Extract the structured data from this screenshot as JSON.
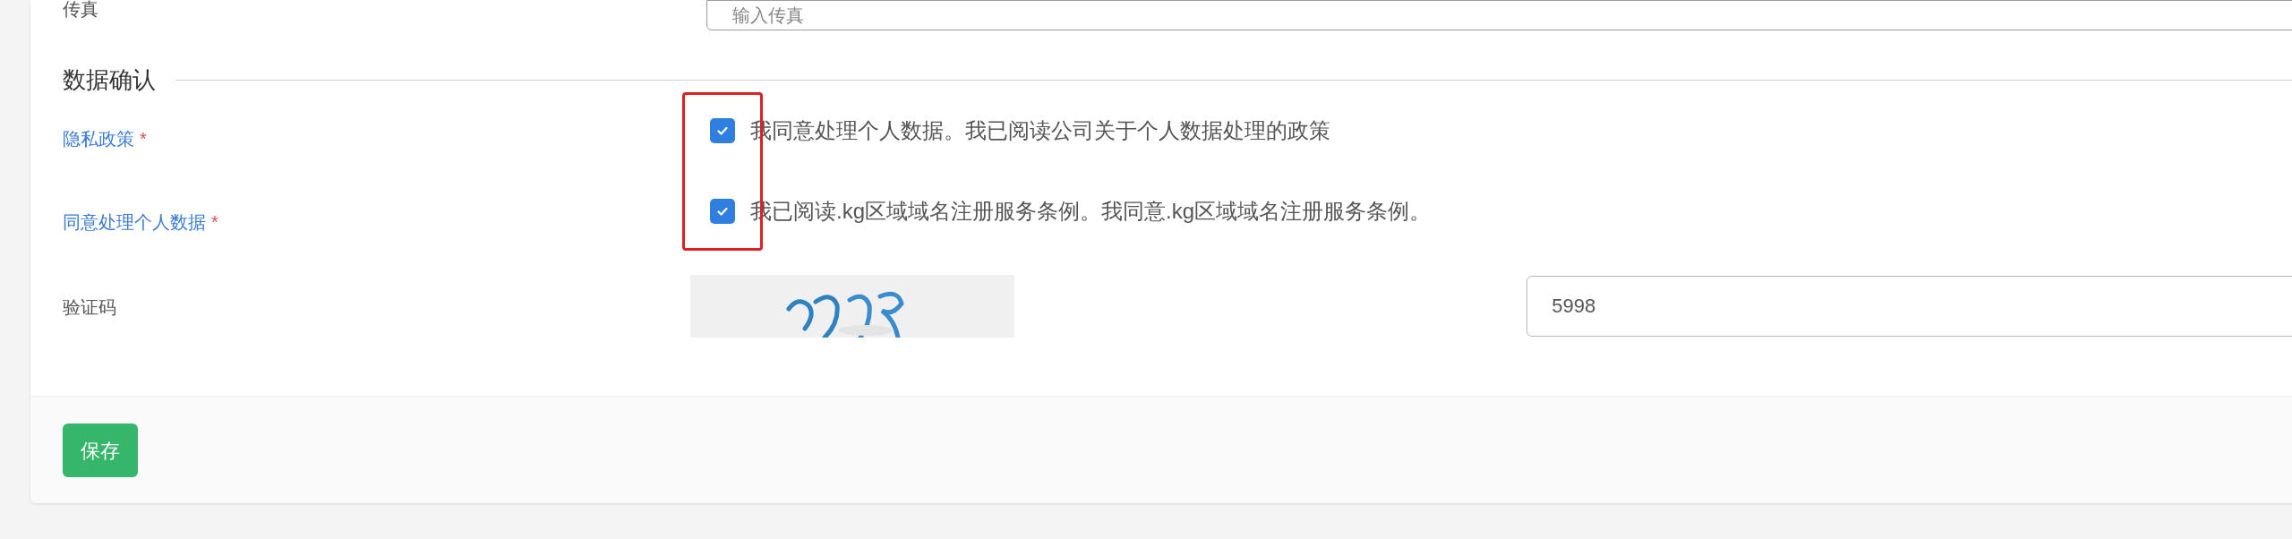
{
  "fax_field": {
    "label": "传真",
    "placeholder": "输入传真"
  },
  "section": {
    "title": "数据确认"
  },
  "consents": [
    {
      "label": "隐私政策",
      "required": "*",
      "text": "我同意处理个人数据。我已阅读公司关于个人数据处理的政策",
      "checked": true
    },
    {
      "label": "同意处理个人数据",
      "required": "*",
      "text": "我已阅读.kg区域域名注册服务条例。我同意.kg区域域名注册服务条例。",
      "checked": true
    }
  ],
  "highlight_frame": true,
  "captcha": {
    "label": "验证码",
    "value": "5998"
  },
  "save_button": "保存"
}
